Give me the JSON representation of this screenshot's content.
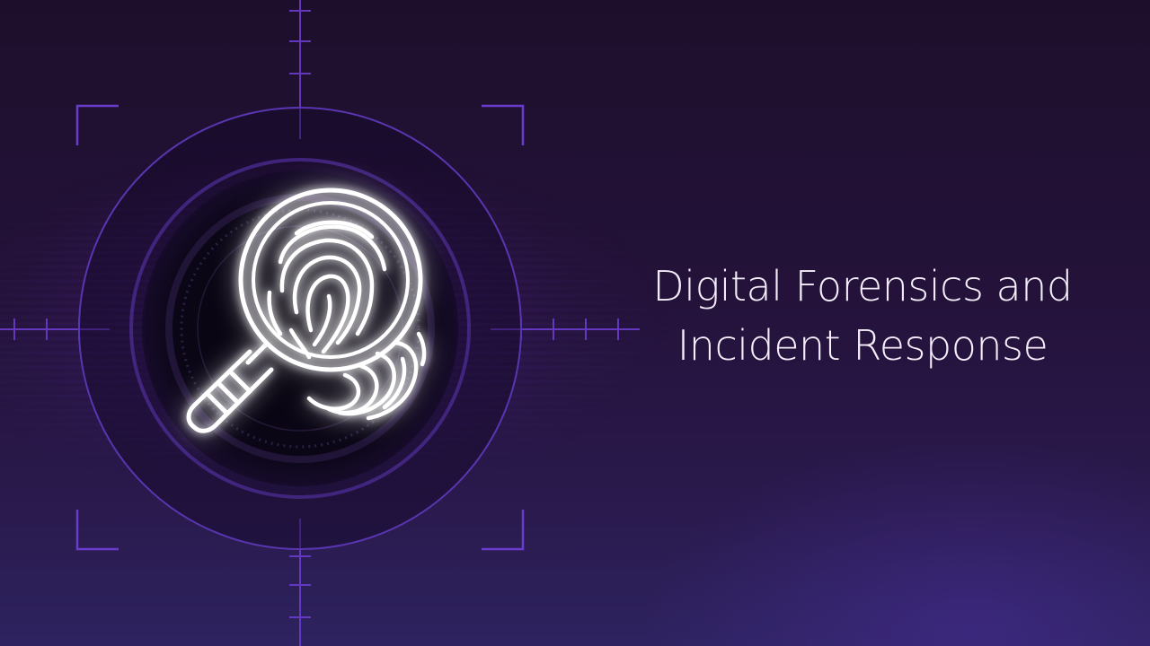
{
  "banner": {
    "title_line1": "Digital Forensics and",
    "title_line2": "Incident Response",
    "icon": "fingerprint-magnifier-icon",
    "colors": {
      "background_top": "#1d0f2b",
      "background_bottom": "#2e2360",
      "accent_purple": "#6a3ccc",
      "glow_blue": "#3a2bff",
      "glyph_white": "#ffffff",
      "text": "#f3eef9"
    }
  }
}
